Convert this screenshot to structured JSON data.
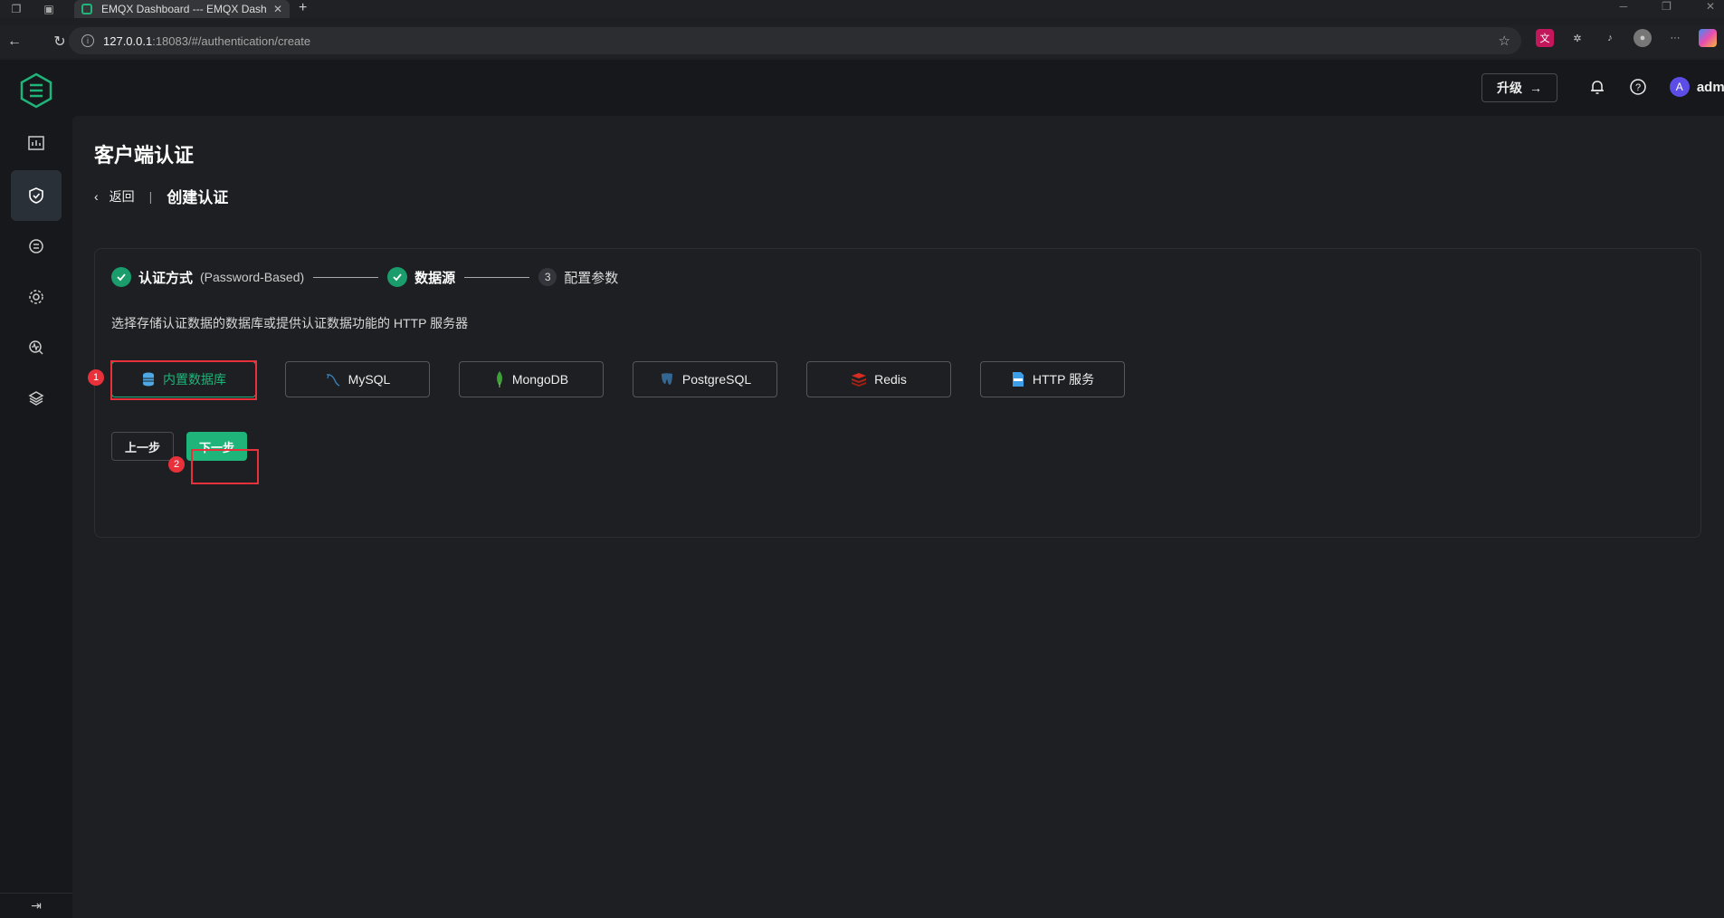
{
  "browser": {
    "tab_title": "EMQX Dashboard --- EMQX Dash",
    "url_host": "127.0.0.1",
    "url_path": ":18083/#/authentication/create"
  },
  "topbar": {
    "upgrade_label": "升级",
    "user_initial": "A",
    "user_name": "admin"
  },
  "page": {
    "title": "客户端认证",
    "back_label": "返回",
    "breadcrumb_current": "创建认证"
  },
  "steps": [
    {
      "label": "认证方式",
      "sub": "(Password-Based)",
      "state": "done"
    },
    {
      "label": "数据源",
      "state": "done"
    },
    {
      "number": "3",
      "label": "配置参数",
      "state": "pending"
    }
  ],
  "description": "选择存储认证数据的数据库或提供认证数据功能的 HTTP 服务器",
  "sources": [
    {
      "label": "内置数据库",
      "icon": "database-icon",
      "selected": true
    },
    {
      "label": "MySQL",
      "icon": "mysql-icon",
      "selected": false
    },
    {
      "label": "MongoDB",
      "icon": "mongodb-icon",
      "selected": false
    },
    {
      "label": "PostgreSQL",
      "icon": "postgresql-icon",
      "selected": false
    },
    {
      "label": "Redis",
      "icon": "redis-icon",
      "selected": false
    },
    {
      "label": "HTTP 服务",
      "icon": "http-icon",
      "selected": false
    }
  ],
  "actions": {
    "prev_label": "上一步",
    "next_label": "下一步"
  },
  "annotations": {
    "badge_1": "1",
    "badge_2": "2"
  },
  "colors": {
    "accent": "#1fb57a",
    "highlight": "#e8313a"
  }
}
